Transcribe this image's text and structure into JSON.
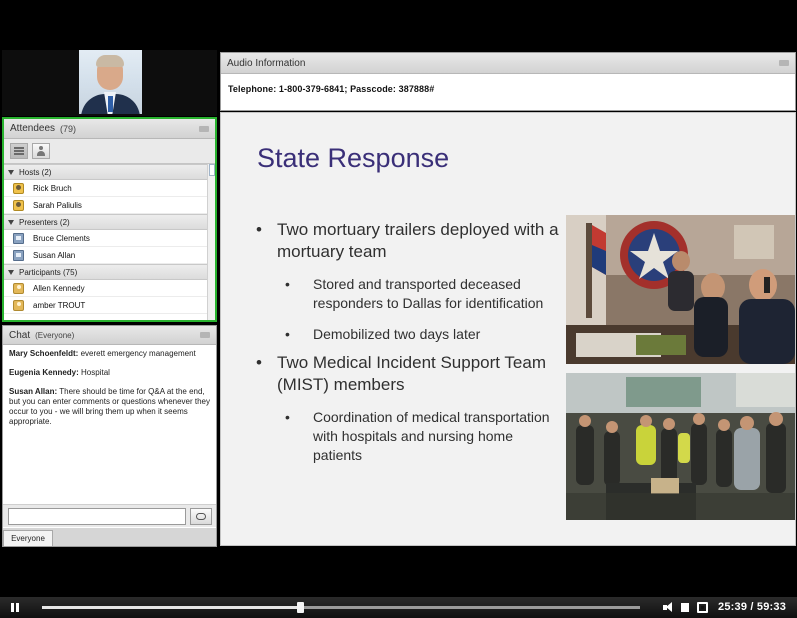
{
  "audio": {
    "title": "Audio Information",
    "telephone": "Telephone: 1-800-379-6841; Passcode: 387888#"
  },
  "attendees": {
    "title": "Attendees",
    "count": "(79)",
    "groups": [
      {
        "label": "Hosts (2)",
        "people": [
          "Rick Bruch",
          "Sarah Paliulis"
        ]
      },
      {
        "label": "Presenters (2)",
        "people": [
          "Bruce Clements",
          "Susan Allan"
        ]
      },
      {
        "label": "Participants (75)",
        "people": [
          "Allen Kennedy",
          "amber TROUT"
        ]
      }
    ]
  },
  "chat": {
    "title": "Chat",
    "scope": "(Everyone)",
    "messages": [
      {
        "sender": "Mary Schoenfeldt:",
        "text": "everett emergency management"
      },
      {
        "sender": "Eugenia Kennedy:",
        "text": "Hospital"
      },
      {
        "sender": "Susan Allan:",
        "text": "There should be time for Q&A at the end, but you can enter comments or questions whenever they occur to you - we will bring them up when it seems appropriate."
      }
    ],
    "input_value": "",
    "tab_label": "Everyone"
  },
  "slide": {
    "title": "State Response",
    "bullets": [
      {
        "text": "Two mortuary trailers deployed with a mortuary team",
        "sub": [
          "Stored and transported deceased responders to Dallas for identification",
          "Demobilized two days later"
        ]
      },
      {
        "text": "Two Medical Incident Support Team (MIST) members",
        "sub": [
          "Coordination of medical transportation with hospitals and nursing home patients"
        ]
      }
    ]
  },
  "player": {
    "time": "25:39 / 59:33",
    "progress": 0.431
  }
}
